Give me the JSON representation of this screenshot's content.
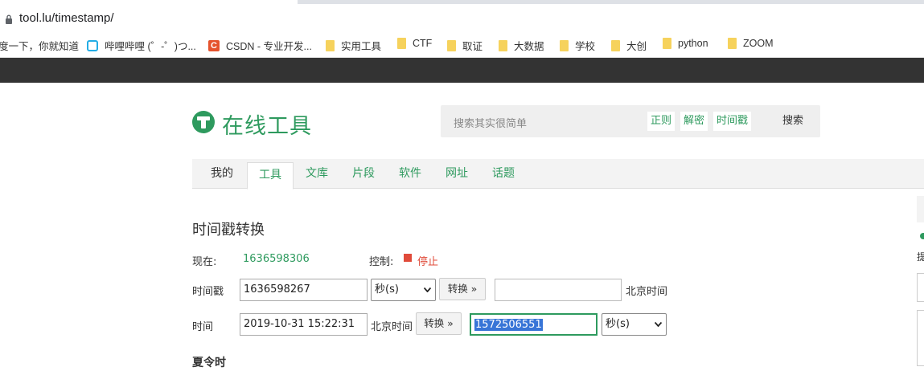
{
  "browser": {
    "url": "tool.lu/timestamp/",
    "bookmarks": [
      {
        "label": "度一下，你就知道",
        "icon": "none"
      },
      {
        "label": "哔哩哔哩 (゜-゜)つ...",
        "icon": "bilibili-icon"
      },
      {
        "label": "CSDN - 专业开发...",
        "icon": "csdn-icon"
      },
      {
        "label": "实用工具",
        "icon": "folder-icon"
      },
      {
        "label": "CTF",
        "icon": "folder-icon"
      },
      {
        "label": "取证",
        "icon": "folder-icon"
      },
      {
        "label": "大数据",
        "icon": "folder-icon"
      },
      {
        "label": "学校",
        "icon": "folder-icon"
      },
      {
        "label": "大创",
        "icon": "folder-icon"
      },
      {
        "label": "python",
        "icon": "folder-icon"
      },
      {
        "label": "ZOOM",
        "icon": "folder-icon"
      }
    ]
  },
  "site": {
    "logo_text": "在线工具",
    "search": {
      "placeholder": "搜索其实很简单",
      "quick_links": [
        "正则",
        "解密",
        "时间戳"
      ],
      "button": "搜索"
    },
    "nav": [
      "我的",
      "工具",
      "文库",
      "片段",
      "软件",
      "网址",
      "话题"
    ],
    "active_nav": "工具",
    "side_char": "提"
  },
  "tool": {
    "title": "时间戳转换",
    "now_label": "现在:",
    "now_value": "1636598306",
    "control_label": "控制:",
    "stop_label": "停止",
    "row1": {
      "label": "时间戳",
      "input": "1636598267",
      "unit": "秒(s)",
      "button": "转换 »",
      "output": "",
      "suffix": "北京时间"
    },
    "row2": {
      "label": "时间",
      "input": "2019-10-31 15:22:31",
      "tz": "北京时间",
      "button": "转换 »",
      "output": "1572506551",
      "unit": "秒(s)"
    },
    "dst_title": "夏令时"
  },
  "colors": {
    "brand_green": "#2e9a5e",
    "stop_red": "#e04b3a",
    "dark_bar": "#333333",
    "selection_blue": "#3875d7"
  }
}
